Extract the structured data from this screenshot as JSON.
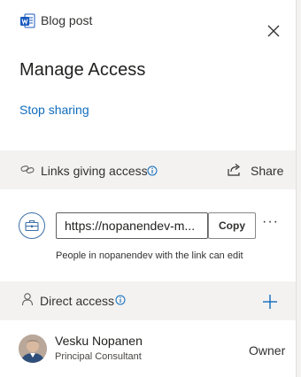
{
  "header": {
    "file_icon": "word-document-icon",
    "file_name": "Blog post",
    "close_icon": "close-icon"
  },
  "title": "Manage Access",
  "stop_sharing": "Stop sharing",
  "links_section": {
    "label": "Links giving access",
    "icon": "link-icon",
    "info_icon": "info-icon",
    "share_label": "Share",
    "share_icon": "share-icon"
  },
  "link_item": {
    "icon": "briefcase-icon",
    "url": "https://nopanendev-m...",
    "copy_label": "Copy",
    "more_icon": "more-icon",
    "more_glyph": "···",
    "description": "People in nopanendev with the link can edit"
  },
  "direct_section": {
    "label": "Direct access",
    "icon": "person-icon",
    "info_icon": "info-icon",
    "add_icon": "plus-icon"
  },
  "people": [
    {
      "name": "Vesku Nopanen",
      "title": "Principal Consultant",
      "role": "Owner"
    }
  ],
  "colors": {
    "accent": "#0f6cbd",
    "section_bg": "#f3f2f1",
    "word_blue": "#185abd"
  }
}
